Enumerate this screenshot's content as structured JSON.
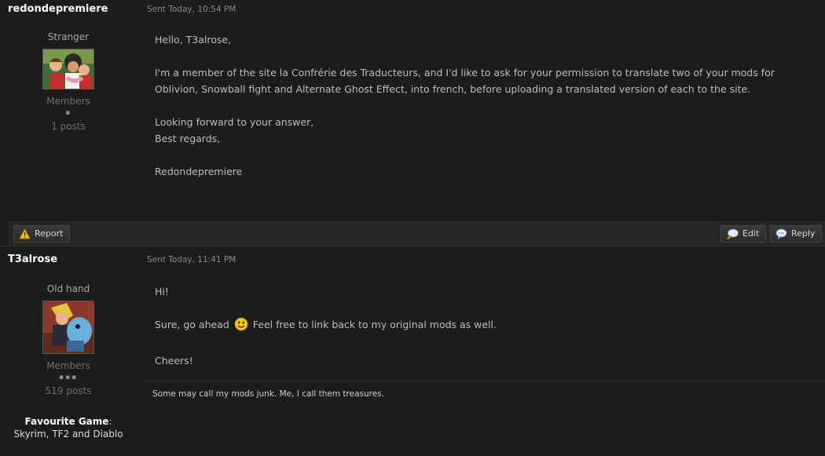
{
  "posts": [
    {
      "author": "redondepremiere",
      "date": "Sent Today, 10:54 PM",
      "rank": "Stranger",
      "group": "Members",
      "pips": "▪",
      "posts_count": "1 posts",
      "body": [
        "Hello, T3alrose,",
        "",
        "I'm a member of the site la Confrérie des Traducteurs, and I'd like to ask for your permission to translate two of your mods for",
        "Oblivion, Snowball fight and Alternate Ghost Effect, into french, before uploading a translated version of each to the site.",
        "",
        "Looking forward to your answer,",
        "Best regards,",
        "",
        "Redondepremiere"
      ],
      "actions": {
        "report": "Report",
        "edit": "Edit",
        "reply": "Reply"
      }
    },
    {
      "author": "T3alrose",
      "date": "Sent Today, 11:41 PM",
      "rank": "Old hand",
      "group": "Members",
      "pips": "▪▪▪",
      "posts_count": "519 posts",
      "body_line1": "Hi!",
      "body_line2_before": "Sure, go ahead",
      "body_line2_after": "Feel free to link back to my original mods as well.",
      "body_line3": "Cheers!",
      "signature": "Some may call my mods junk. Me, I call them treasures.",
      "custom_field_label": "Favourite Game",
      "custom_field_colon": ":",
      "custom_field_value": "Skyrim, TF2 and Diablo"
    }
  ],
  "colors": {
    "background": "#1c1c1c",
    "author": "#ffffff",
    "body_text": "#bdbdbd",
    "muted": "#6e6e6e",
    "smiley": "#f5c518"
  },
  "icons": {
    "report": "warning-icon",
    "edit": "edit-icon",
    "reply": "reply-icon",
    "smiley": "smiley-icon"
  }
}
